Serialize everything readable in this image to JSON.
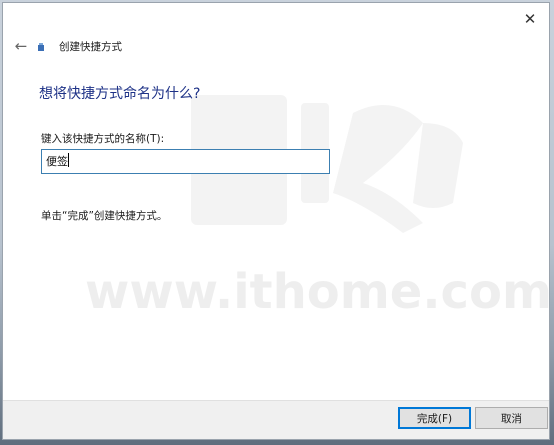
{
  "window": {
    "close_glyph": "✕"
  },
  "header": {
    "back_glyph": "←",
    "title": "创建快捷方式"
  },
  "main": {
    "heading": "想将快捷方式命名为什么?",
    "field_label": "键入该快捷方式的名称(T):",
    "name_value": "便签",
    "hint": "单击“完成”创建快捷方式。"
  },
  "footer": {
    "finish_label": "完成(F)",
    "cancel_label": "取消"
  },
  "watermark": {
    "text": "www.ithome.com"
  },
  "colors": {
    "heading": "#1e3287",
    "input_border": "#3c7fb1",
    "primary_border": "#0078d7"
  }
}
